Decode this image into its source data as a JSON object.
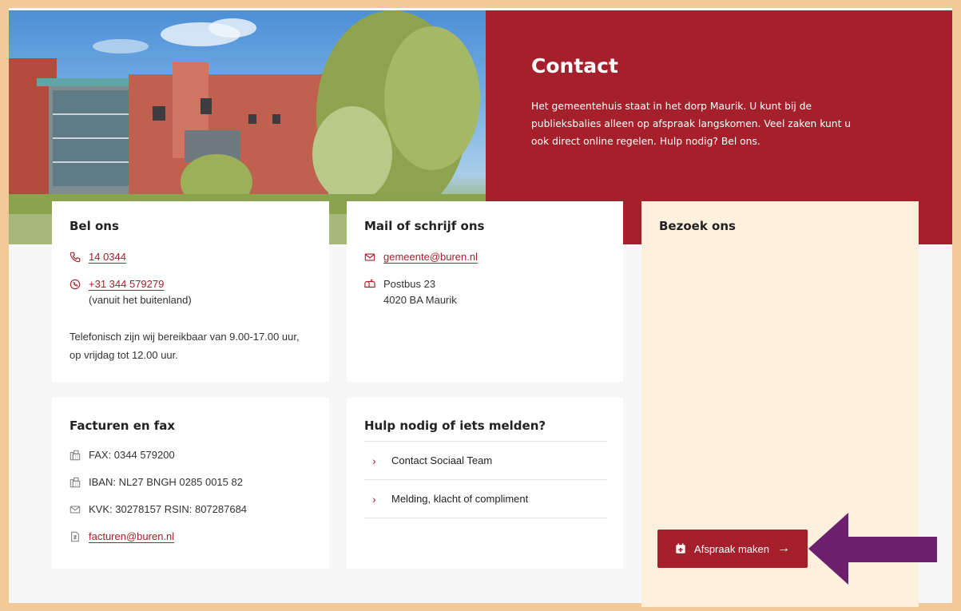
{
  "hero": {
    "title": "Contact",
    "text": "Het gemeentehuis staat in het dorp Maurik. U kunt bij de publieksbalies alleen op afspraak langskomen. Veel zaken kunt u ook direct online regelen. Hulp nodig? Bel ons."
  },
  "bel": {
    "title": "Bel ons",
    "phone": "14 0344",
    "intl_phone": "+31 344 579279",
    "intl_note": "(vanuit het buitenland)",
    "hours": "Telefonisch zijn wij bereikbaar van 9.00-17.00 uur, op vrijdag tot 12.00 uur."
  },
  "mail": {
    "title": "Mail of schrijf ons",
    "email": "gemeente@buren.nl",
    "postbus": "Postbus 23",
    "postcode": "4020 BA Maurik"
  },
  "bezoek": {
    "title": "Bezoek ons",
    "button_label": "Afspraak maken"
  },
  "facturen": {
    "title": "Facturen en fax",
    "fax": "FAX: 0344 579200",
    "iban": "IBAN: NL27 BNGH 0285 0015 82",
    "kvk": "KVK: 30278157 RSIN: 807287684",
    "email": "facturen@buren.nl"
  },
  "hulp": {
    "title": "Hulp nodig of iets melden?",
    "items": [
      "Contact Sociaal Team",
      "Melding, klacht of compliment"
    ]
  },
  "colors": {
    "brand_red": "#a5202a",
    "visit_bg": "#fdf0dc",
    "frame": "#f2c999",
    "annotation_arrow": "#6b1f6e"
  }
}
